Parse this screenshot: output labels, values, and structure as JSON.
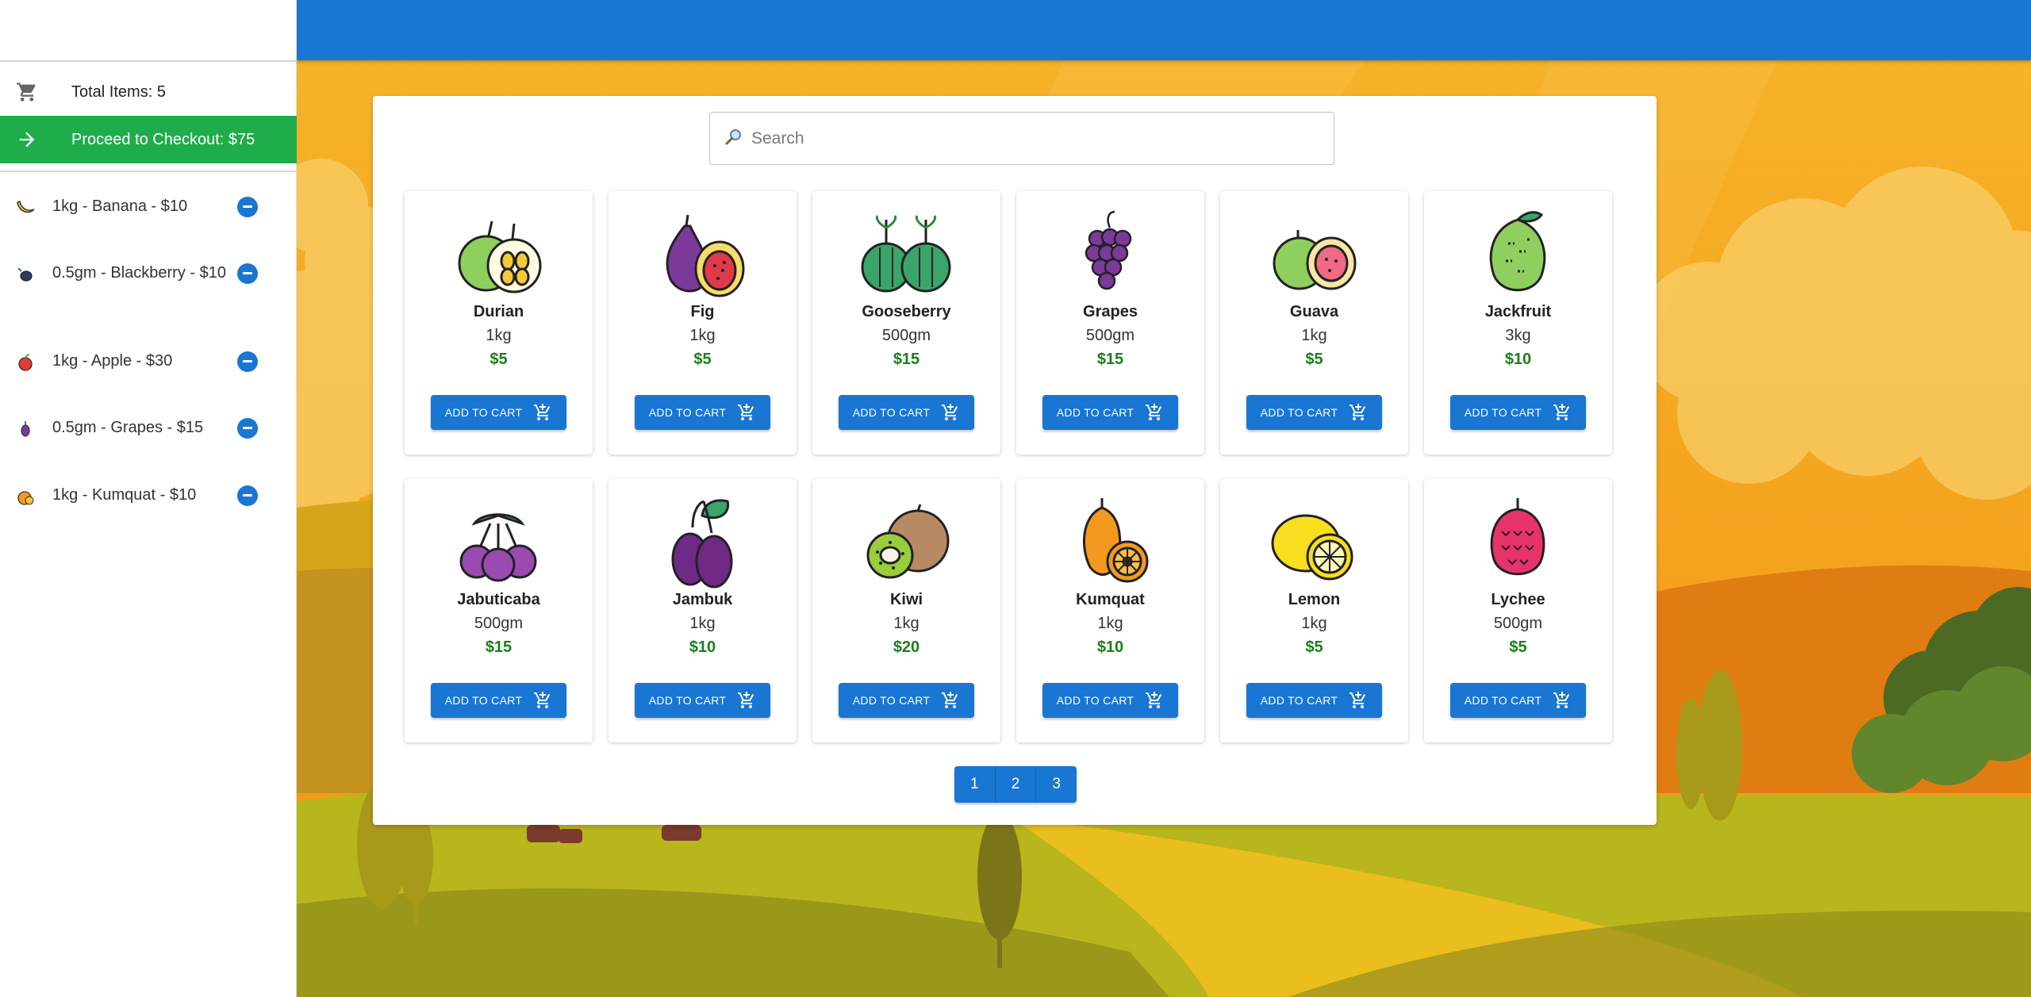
{
  "cart": {
    "total_label": "Total Items: 5",
    "checkout_label": "Proceed to Checkout: $75",
    "items": [
      {
        "label": "1kg - Banana - $10",
        "icon": "banana-icon"
      },
      {
        "label": "0.5gm - Blackberry - $10",
        "icon": "blackberry-icon"
      },
      {
        "label": "1kg - Apple - $30",
        "icon": "apple-icon"
      },
      {
        "label": "0.5gm - Grapes - $15",
        "icon": "grapes-icon"
      },
      {
        "label": "1kg - Kumquat - $10",
        "icon": "kumquat-icon"
      }
    ]
  },
  "search": {
    "placeholder": "Search"
  },
  "add_to_cart_label": "ADD TO CART",
  "products": [
    {
      "name": "Durian",
      "weight": "1kg",
      "price": "$5",
      "icon": "durian-icon"
    },
    {
      "name": "Fig",
      "weight": "1kg",
      "price": "$5",
      "icon": "fig-icon"
    },
    {
      "name": "Gooseberry",
      "weight": "500gm",
      "price": "$15",
      "icon": "gooseberry-icon"
    },
    {
      "name": "Grapes",
      "weight": "500gm",
      "price": "$15",
      "icon": "grapes-icon"
    },
    {
      "name": "Guava",
      "weight": "1kg",
      "price": "$5",
      "icon": "guava-icon"
    },
    {
      "name": "Jackfruit",
      "weight": "3kg",
      "price": "$10",
      "icon": "jackfruit-icon"
    },
    {
      "name": "Jabuticaba",
      "weight": "500gm",
      "price": "$15",
      "icon": "jabuticaba-icon"
    },
    {
      "name": "Jambuk",
      "weight": "1kg",
      "price": "$10",
      "icon": "jambuk-icon"
    },
    {
      "name": "Kiwi",
      "weight": "1kg",
      "price": "$20",
      "icon": "kiwi-icon"
    },
    {
      "name": "Kumquat",
      "weight": "1kg",
      "price": "$10",
      "icon": "kumquat-icon"
    },
    {
      "name": "Lemon",
      "weight": "1kg",
      "price": "$5",
      "icon": "lemon-icon"
    },
    {
      "name": "Lychee",
      "weight": "500gm",
      "price": "$5",
      "icon": "lychee-icon"
    }
  ],
  "pagination": {
    "pages": [
      "1",
      "2",
      "3"
    ]
  },
  "colors": {
    "primary": "#1976d2",
    "checkout": "#1fac4b",
    "price": "#1b7f1b"
  }
}
